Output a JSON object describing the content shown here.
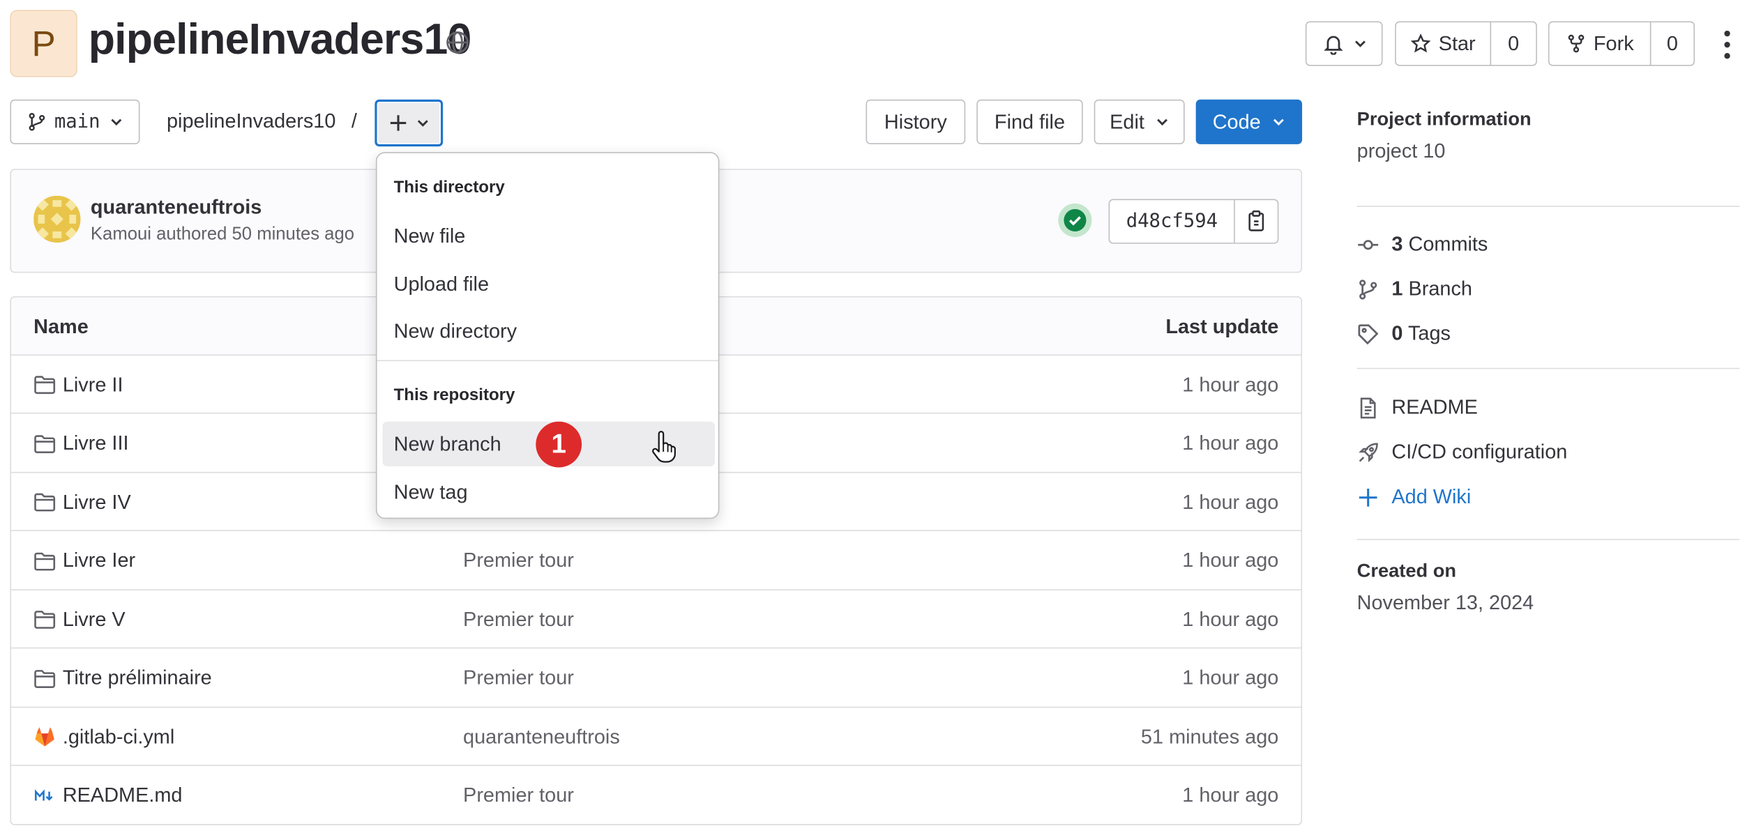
{
  "header": {
    "avatar_letter": "P",
    "project_title": "pipelineInvaders10",
    "star_label": "Star",
    "star_count": "0",
    "fork_label": "Fork",
    "fork_count": "0"
  },
  "toolbar": {
    "branch": "main",
    "breadcrumb_project": "pipelineInvaders10",
    "breadcrumb_sep": "/",
    "history_label": "History",
    "find_file_label": "Find file",
    "edit_label": "Edit",
    "code_label": "Code"
  },
  "commit": {
    "title": "quaranteneuftrois",
    "meta": "Kamoui authored 50 minutes ago",
    "sha": "d48cf594",
    "status_color": "#108548"
  },
  "table": {
    "headers": {
      "name": "Name",
      "last_update": "Last update"
    },
    "rows": [
      {
        "icon": "folder-icon",
        "name": "Livre II",
        "message": "",
        "date": "1 hour ago"
      },
      {
        "icon": "folder-icon",
        "name": "Livre III",
        "message": "",
        "date": "1 hour ago"
      },
      {
        "icon": "folder-icon",
        "name": "Livre IV",
        "message": "",
        "date": "1 hour ago"
      },
      {
        "icon": "folder-icon",
        "name": "Livre Ier",
        "message": "Premier tour",
        "date": "1 hour ago"
      },
      {
        "icon": "folder-icon",
        "name": "Livre V",
        "message": "Premier tour",
        "date": "1 hour ago"
      },
      {
        "icon": "folder-icon",
        "name": "Titre préliminaire",
        "message": "Premier tour",
        "date": "1 hour ago"
      },
      {
        "icon": "gitlab-icon",
        "name": ".gitlab-ci.yml",
        "message": "quaranteneuftrois",
        "date": "51 minutes ago"
      },
      {
        "icon": "markdown-icon",
        "name": "README.md",
        "message": "Premier tour",
        "date": "1 hour ago"
      }
    ]
  },
  "dropdown": {
    "section1_header": "This directory",
    "section1_items": [
      "New file",
      "Upload file",
      "New directory"
    ],
    "section2_header": "This repository",
    "section2_items": [
      "New branch",
      "New tag"
    ],
    "step_badge": "1",
    "badge_color": "#dd2b2b"
  },
  "sidebar": {
    "project_info_label": "Project information",
    "project_description": "project 10",
    "commits_count": "3",
    "commits_label": "Commits",
    "branch_count": "1",
    "branch_label": "Branch",
    "tags_count": "0",
    "tags_label": "Tags",
    "readme_label": "README",
    "cicd_label": "CI/CD configuration",
    "add_wiki_label": "Add Wiki",
    "created_on_label": "Created on",
    "created_on_date": "November 13, 2024"
  },
  "colors": {
    "accent": "#1f75cb",
    "link": "#1f75cb",
    "success": "#108548"
  }
}
